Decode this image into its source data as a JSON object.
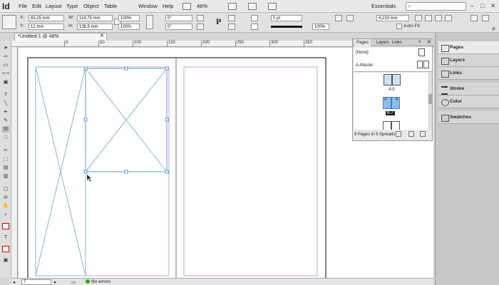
{
  "app": {
    "logo": "Id",
    "menu": [
      "File",
      "Edit",
      "Layout",
      "Type",
      "Object",
      "Table",
      "Window",
      "Help"
    ],
    "zoom": "48%",
    "workspace": "Essentials"
  },
  "control": {
    "x_label": "X:",
    "x_value": "83,25 mm",
    "y_label": "Y:",
    "y_value": "12 mm",
    "w_label": "W:",
    "w_value": "114,75 mm",
    "h_label": "H:",
    "h_value": "136,5 mm",
    "scale_x": "100%",
    "scale_y": "100%",
    "rotate": "0°",
    "shear": "0°",
    "stroke_weight": "0 pt",
    "ref_width": "4,233 mm",
    "opacity": "100%",
    "autofit_label": "Auto-Fit"
  },
  "document": {
    "tab_title": "*Untitled-1 @ 48%",
    "ruler_numbers": [
      "0",
      "50",
      "100",
      "150",
      "200",
      "250",
      "300",
      "350"
    ]
  },
  "status": {
    "page": "7",
    "errors": "No errors"
  },
  "pages_panel": {
    "tabs": [
      "Pages",
      "Layers",
      "Links"
    ],
    "masters": [
      "[None]",
      "A-Master"
    ],
    "spread_label_1": "4-5",
    "spread_label_2": "6-7",
    "page_letters": [
      "A",
      "A"
    ],
    "footer": "9 Pages in 5 Spreads"
  },
  "dock": {
    "items": [
      "Pages",
      "Layers",
      "Links",
      "Stroke",
      "Color",
      "Swatches"
    ]
  },
  "colors": {
    "selection": "#5b9bd5",
    "frame_cross": "#8cb4cf",
    "margin": "#c7a3c8",
    "accent_blue": "#3d7fd0"
  }
}
